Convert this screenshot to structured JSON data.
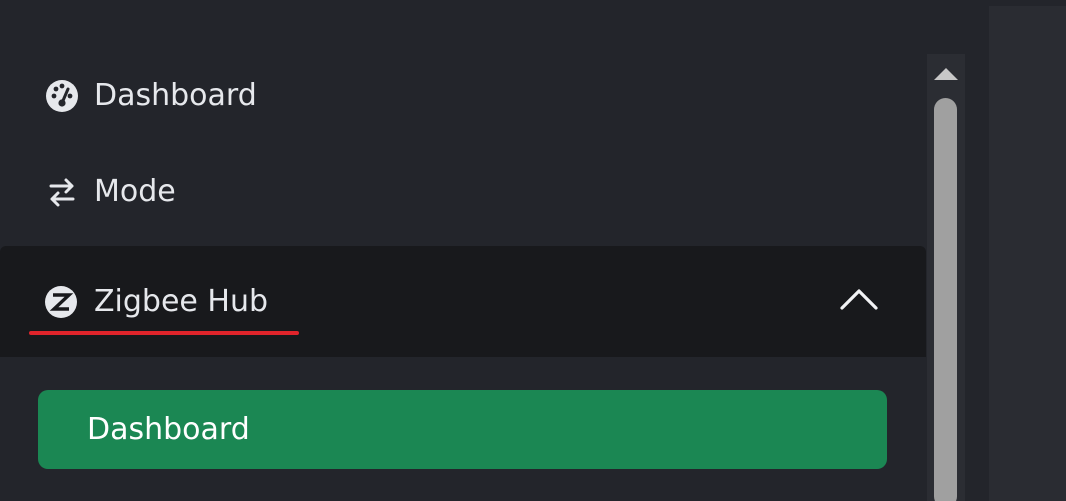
{
  "sidebar": {
    "items": [
      {
        "label": "Dashboard",
        "icon": "dashboard-gauge-icon"
      },
      {
        "label": "Mode",
        "icon": "swap-arrows-icon"
      }
    ],
    "group": {
      "label": "Zigbee Hub",
      "icon": "zigbee-icon",
      "expanded": true,
      "chevron_icon": "chevron-up-icon",
      "underline_color": "#e0242b",
      "sub_items": [
        {
          "label": "Dashboard",
          "active": true
        }
      ]
    }
  },
  "colors": {
    "background": "#23252b",
    "group_header_bg": "#18191c",
    "active_item_bg": "#1b8753",
    "text": "#e6e8ec"
  }
}
